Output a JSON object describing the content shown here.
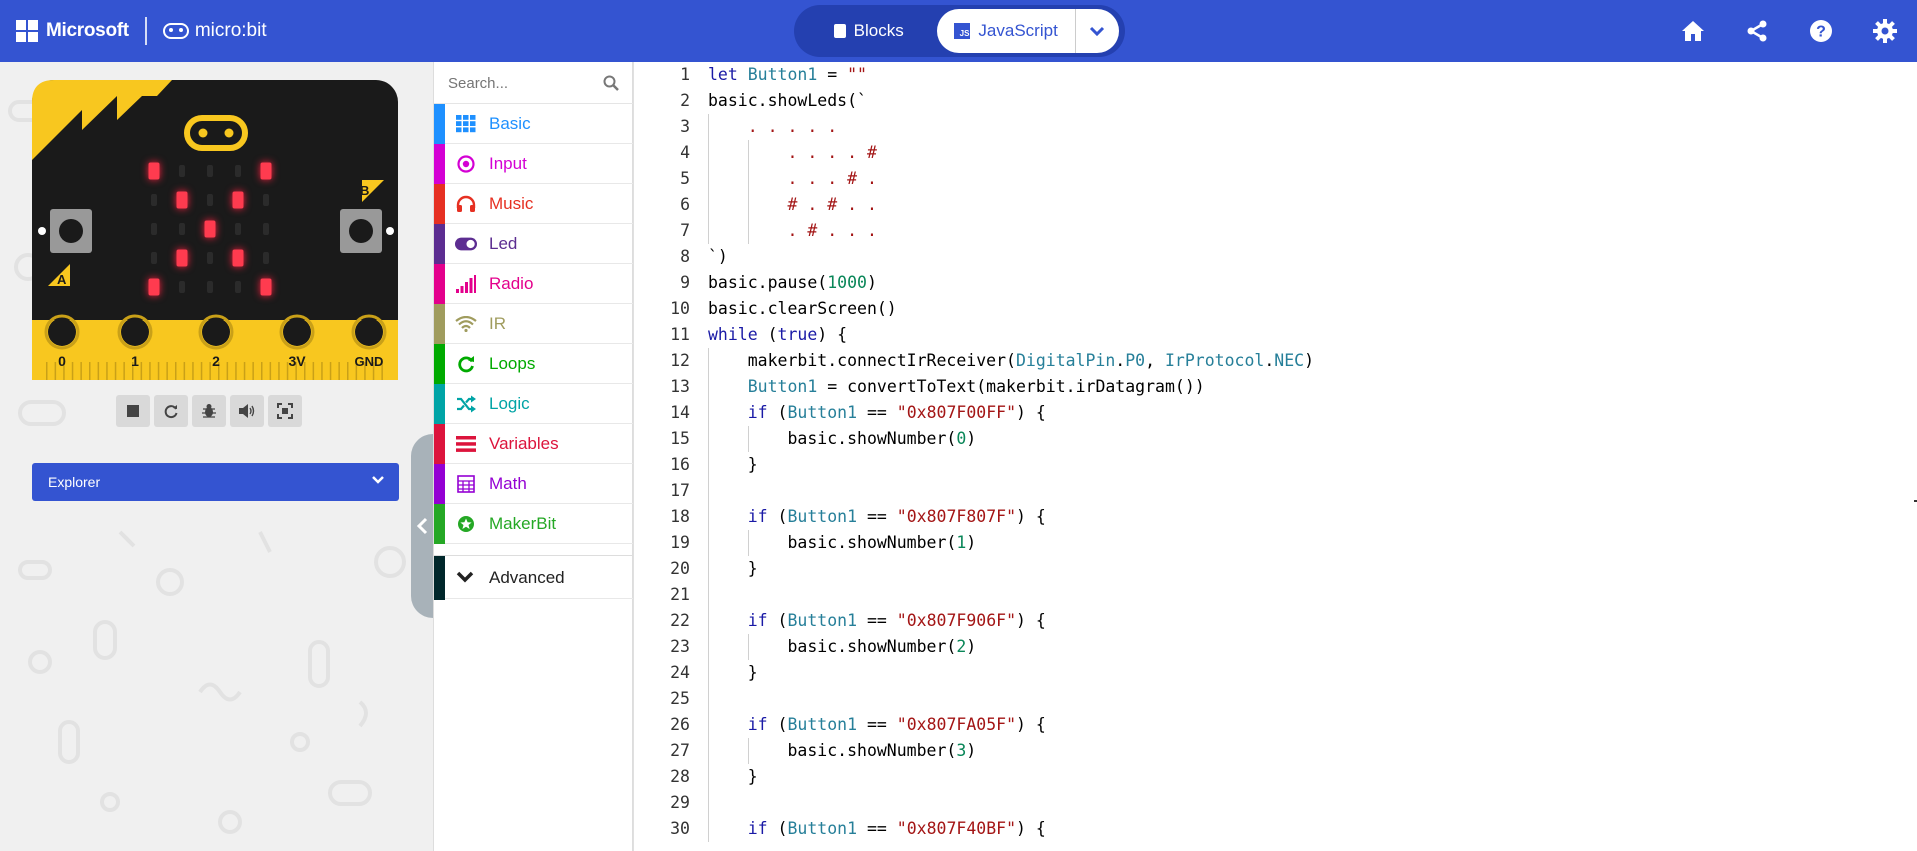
{
  "header": {
    "microsoft_label": "Microsoft",
    "microbit_label": "micro:bit",
    "blocks_label": "Blocks",
    "javascript_label": "JavaScript",
    "js_badge": "JS"
  },
  "simulator": {
    "pin_labels": [
      "0",
      "1",
      "2",
      "3V",
      "GND"
    ],
    "button_a_label": "A",
    "button_b_label": "B",
    "led_rows": [
      ".  .  .  .  .",
      "x . . . x",
      ". x . x .",
      ". . x . .",
      ". x . x .",
      "x . . . x"
    ],
    "leds_lit": [
      [
        1,
        0,
        0,
        0,
        1
      ],
      [
        0,
        1,
        0,
        1,
        0
      ],
      [
        0,
        0,
        1,
        0,
        0
      ],
      [
        0,
        1,
        0,
        1,
        0
      ],
      [
        1,
        0,
        0,
        0,
        1
      ]
    ],
    "explorer_label": "Explorer"
  },
  "toolbox": {
    "search_placeholder": "Search...",
    "categories": [
      {
        "label": "Basic",
        "color": "#1e90ff",
        "icon": "grid-icon"
      },
      {
        "label": "Input",
        "color": "#d400d4",
        "icon": "target-icon"
      },
      {
        "label": "Music",
        "color": "#e63022",
        "icon": "headphones-icon"
      },
      {
        "label": "Led",
        "color": "#5c2d91",
        "icon": "toggle-icon"
      },
      {
        "label": "Radio",
        "color": "#e3008c",
        "icon": "signal-bars-icon"
      },
      {
        "label": "IR",
        "color": "#a09c5e",
        "icon": "wifi-icon"
      },
      {
        "label": "Loops",
        "color": "#00aa00",
        "icon": "refresh-icon"
      },
      {
        "label": "Logic",
        "color": "#00a4a6",
        "icon": "shuffle-icon"
      },
      {
        "label": "Variables",
        "color": "#dc143c",
        "icon": "list-icon"
      },
      {
        "label": "Math",
        "color": "#9400d3",
        "icon": "calculator-icon"
      },
      {
        "label": "MakerBit",
        "color": "#25a825",
        "icon": "star-circle-icon"
      }
    ],
    "advanced_label": "Advanced",
    "advanced_color": "#00272b"
  },
  "editor": {
    "lines": [
      {
        "n": "1",
        "segs": [
          [
            "kw",
            "let "
          ],
          [
            "id",
            "Button1"
          ],
          [
            "",
            " = "
          ],
          [
            "str",
            "\"\""
          ]
        ]
      },
      {
        "n": "2",
        "segs": [
          [
            "",
            "basic.showLeds(`"
          ]
        ]
      },
      {
        "n": "3",
        "segs": [
          [
            "str",
            "    . . . . ."
          ]
        ]
      },
      {
        "n": "4",
        "segs": [
          [
            "str",
            "        . . . . #"
          ]
        ]
      },
      {
        "n": "5",
        "segs": [
          [
            "str",
            "        . . . # ."
          ]
        ]
      },
      {
        "n": "6",
        "segs": [
          [
            "str",
            "        # . # . ."
          ]
        ]
      },
      {
        "n": "7",
        "segs": [
          [
            "str",
            "        . # . . ."
          ]
        ]
      },
      {
        "n": "8",
        "segs": [
          [
            "",
            "`)"
          ]
        ]
      },
      {
        "n": "9",
        "segs": [
          [
            "",
            "basic.pause("
          ],
          [
            "num",
            "1000"
          ],
          [
            "",
            ")"
          ]
        ]
      },
      {
        "n": "10",
        "segs": [
          [
            "",
            "basic.clearScreen()"
          ]
        ]
      },
      {
        "n": "11",
        "segs": [
          [
            "kw",
            "while"
          ],
          [
            "",
            " ("
          ],
          [
            "kw",
            "true"
          ],
          [
            "",
            ") {"
          ]
        ]
      },
      {
        "n": "12",
        "segs": [
          [
            "",
            "    makerbit.connectIrReceiver("
          ],
          [
            "id",
            "DigitalPin"
          ],
          [
            "",
            "."
          ],
          [
            "id",
            "P0"
          ],
          [
            "",
            ", "
          ],
          [
            "id",
            "IrProtocol"
          ],
          [
            "",
            "."
          ],
          [
            "id",
            "NEC"
          ],
          [
            "",
            ")"
          ]
        ]
      },
      {
        "n": "13",
        "segs": [
          [
            "",
            "    "
          ],
          [
            "id",
            "Button1"
          ],
          [
            "",
            " = convertToText(makerbit.irDatagram())"
          ]
        ]
      },
      {
        "n": "14",
        "segs": [
          [
            "",
            "    "
          ],
          [
            "kw",
            "if"
          ],
          [
            "",
            " ("
          ],
          [
            "id",
            "Button1"
          ],
          [
            "",
            " == "
          ],
          [
            "str",
            "\"0x807F00FF\""
          ],
          [
            "",
            ") {"
          ]
        ]
      },
      {
        "n": "15",
        "segs": [
          [
            "",
            "        basic.showNumber("
          ],
          [
            "num",
            "0"
          ],
          [
            "",
            ")"
          ]
        ]
      },
      {
        "n": "16",
        "segs": [
          [
            "",
            "    }"
          ]
        ]
      },
      {
        "n": "17",
        "segs": [
          [
            "",
            ""
          ]
        ]
      },
      {
        "n": "18",
        "segs": [
          [
            "",
            "    "
          ],
          [
            "kw",
            "if"
          ],
          [
            "",
            " ("
          ],
          [
            "id",
            "Button1"
          ],
          [
            "",
            " == "
          ],
          [
            "str",
            "\"0x807F807F\""
          ],
          [
            "",
            ") {"
          ]
        ]
      },
      {
        "n": "19",
        "segs": [
          [
            "",
            "        basic.showNumber("
          ],
          [
            "num",
            "1"
          ],
          [
            "",
            ")"
          ]
        ]
      },
      {
        "n": "20",
        "segs": [
          [
            "",
            "    }"
          ]
        ]
      },
      {
        "n": "21",
        "segs": [
          [
            "",
            ""
          ]
        ]
      },
      {
        "n": "22",
        "segs": [
          [
            "",
            "    "
          ],
          [
            "kw",
            "if"
          ],
          [
            "",
            " ("
          ],
          [
            "id",
            "Button1"
          ],
          [
            "",
            " == "
          ],
          [
            "str",
            "\"0x807F906F\""
          ],
          [
            "",
            ") {"
          ]
        ]
      },
      {
        "n": "23",
        "segs": [
          [
            "",
            "        basic.showNumber("
          ],
          [
            "num",
            "2"
          ],
          [
            "",
            ")"
          ]
        ]
      },
      {
        "n": "24",
        "segs": [
          [
            "",
            "    }"
          ]
        ]
      },
      {
        "n": "25",
        "segs": [
          [
            "",
            ""
          ]
        ]
      },
      {
        "n": "26",
        "segs": [
          [
            "",
            "    "
          ],
          [
            "kw",
            "if"
          ],
          [
            "",
            " ("
          ],
          [
            "id",
            "Button1"
          ],
          [
            "",
            " == "
          ],
          [
            "str",
            "\"0x807FA05F\""
          ],
          [
            "",
            ") {"
          ]
        ]
      },
      {
        "n": "27",
        "segs": [
          [
            "",
            "        basic.showNumber("
          ],
          [
            "num",
            "3"
          ],
          [
            "",
            ")"
          ]
        ]
      },
      {
        "n": "28",
        "segs": [
          [
            "",
            "    }"
          ]
        ]
      },
      {
        "n": "29",
        "segs": [
          [
            "",
            ""
          ]
        ]
      },
      {
        "n": "30",
        "segs": [
          [
            "",
            "    "
          ],
          [
            "kw",
            "if"
          ],
          [
            "",
            " ("
          ],
          [
            "id",
            "Button1"
          ],
          [
            "",
            " == "
          ],
          [
            "str",
            "\"0x807F40BF\""
          ],
          [
            "",
            ") {"
          ]
        ]
      }
    ]
  }
}
